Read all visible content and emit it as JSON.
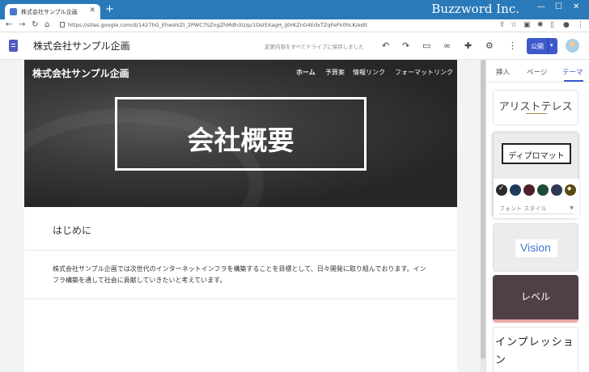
{
  "browser": {
    "tab_title": "株式会社サンプル企画",
    "close_glyph": "✕",
    "new_tab_glyph": "+",
    "url": "https://sites.google.com/d/1427hG_EhxoIVZI_2PWC7SZngZhMdh3Iz/p/1DsISXagH_iJ0rKZnG4EdxTZqFeFk0hLK/edit",
    "brand": "Buzzword Inc."
  },
  "editor": {
    "site_name": "株式会社サンプル企画",
    "save_status": "変更内容をすべてドライブに保存しました",
    "publish_label": "公開",
    "accent_color": "#3d5acb"
  },
  "site": {
    "header_title": "株式会社サンプル企画",
    "nav": [
      "ホーム",
      "予算案",
      "情報リンク",
      "フォーマットリンク"
    ],
    "hero_title": "会社概要",
    "section_heading": "はじめに",
    "body_text": "株式会社サンプル企画では次世代のインターネットインフラを構築することを目標として、日々開発に取り組んでおります。インフラ構築を通して社会に貢献していきたいと考えています。"
  },
  "panel": {
    "tabs": [
      "挿入",
      "ページ",
      "テーマ"
    ],
    "active_tab": "テーマ",
    "themes": [
      "アリストテレス",
      "ディプロマット",
      "Vision",
      "レベル",
      "インプレッション"
    ],
    "selected_theme": "ディプロマット",
    "color_swatches": [
      "#2b2b2b",
      "#1e3b5a",
      "#4f1f2a",
      "#1f4a3a",
      "#2d3756",
      "#5b4a14"
    ],
    "font_style_label": "フォント スタイル"
  }
}
